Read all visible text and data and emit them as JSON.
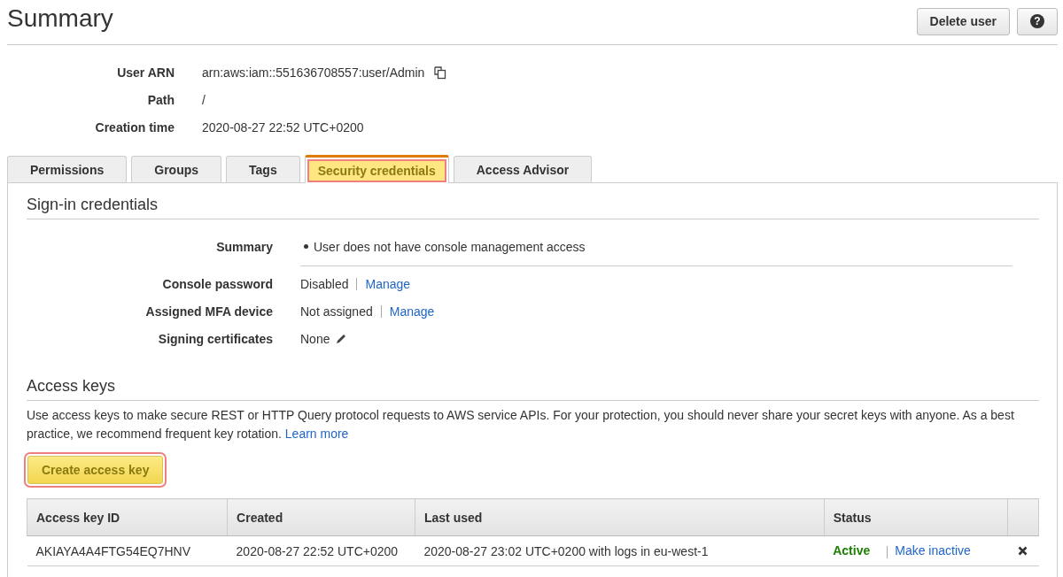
{
  "header": {
    "title": "Summary",
    "buttons": [
      {
        "label": "Delete user",
        "kind": "text"
      },
      {
        "label": "?",
        "kind": "help"
      }
    ]
  },
  "details": [
    {
      "label": "User ARN",
      "value": "arn:aws:iam::551636708557:user/Admin",
      "copyable": true
    },
    {
      "label": "Path",
      "value": "/",
      "copyable": false
    },
    {
      "label": "Creation time",
      "value": "2020-08-27 22:52 UTC+0200",
      "copyable": false
    }
  ],
  "tabs": [
    {
      "label": "Permissions",
      "selected": false,
      "highlighted": false
    },
    {
      "label": "Groups",
      "selected": false,
      "highlighted": false
    },
    {
      "label": "Tags",
      "selected": false,
      "highlighted": false
    },
    {
      "label": "Security credentials",
      "selected": true,
      "highlighted": true
    },
    {
      "label": "Access Advisor",
      "selected": false,
      "highlighted": false
    }
  ],
  "sign_in": {
    "heading": "Sign-in credentials",
    "rows": [
      {
        "label": "Summary",
        "kind": "bullet",
        "value": "User does not have console management access"
      },
      {
        "label": "Console password",
        "kind": "link",
        "value": "Disabled",
        "link": "Manage"
      },
      {
        "label": "Assigned MFA device",
        "kind": "link",
        "value": "Not assigned",
        "link": "Manage"
      },
      {
        "label": "Signing certificates",
        "kind": "edit",
        "value": "None"
      }
    ]
  },
  "access_keys": {
    "heading": "Access keys",
    "description": "Use access keys to make secure REST or HTTP Query protocol requests to AWS service APIs. For your protection, you should never share your secret keys with anyone. As a best practice, we recommend frequent key rotation.",
    "learn_more": "Learn more",
    "create_button": {
      "label": "Create access key",
      "highlighted": true
    },
    "table": {
      "columns": [
        "Access key ID",
        "Created",
        "Last used",
        "Status"
      ],
      "rows": [
        {
          "access_key_id": "AKIAYA4A4FTG54EQ7HNV",
          "created": "2020-08-27 22:52 UTC+0200",
          "last_used": "2020-08-27 23:02 UTC+0200 with logs in eu-west-1",
          "status": "Active",
          "active": true,
          "action": "Make inactive"
        }
      ]
    }
  }
}
